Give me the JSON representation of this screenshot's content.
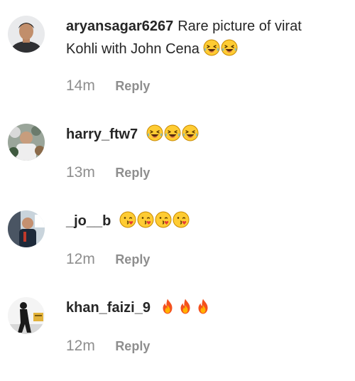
{
  "comments": [
    {
      "username": "aryansagar6267",
      "text_line1": "Rare picture of virat",
      "text_line2": "Kohli with John Cena",
      "emojis": [
        "laughing-tears",
        "laughing-tears"
      ],
      "time": "14m",
      "reply_label": "Reply"
    },
    {
      "username": "harry_ftw7",
      "emojis": [
        "laughing-tears",
        "laughing-tears",
        "laughing-tears"
      ],
      "time": "13m",
      "reply_label": "Reply"
    },
    {
      "username": "_jo__b",
      "emojis": [
        "kissing-face",
        "kissing-face",
        "kissing-face",
        "kissing-face"
      ],
      "time": "12m",
      "reply_label": "Reply"
    },
    {
      "username": "khan_faizi_9",
      "emojis": [
        "fire",
        "fire",
        "fire"
      ],
      "time": "12m",
      "reply_label": "Reply"
    }
  ],
  "colors": {
    "text": "#262626",
    "secondary": "#8e8e8e",
    "background": "#ffffff"
  }
}
